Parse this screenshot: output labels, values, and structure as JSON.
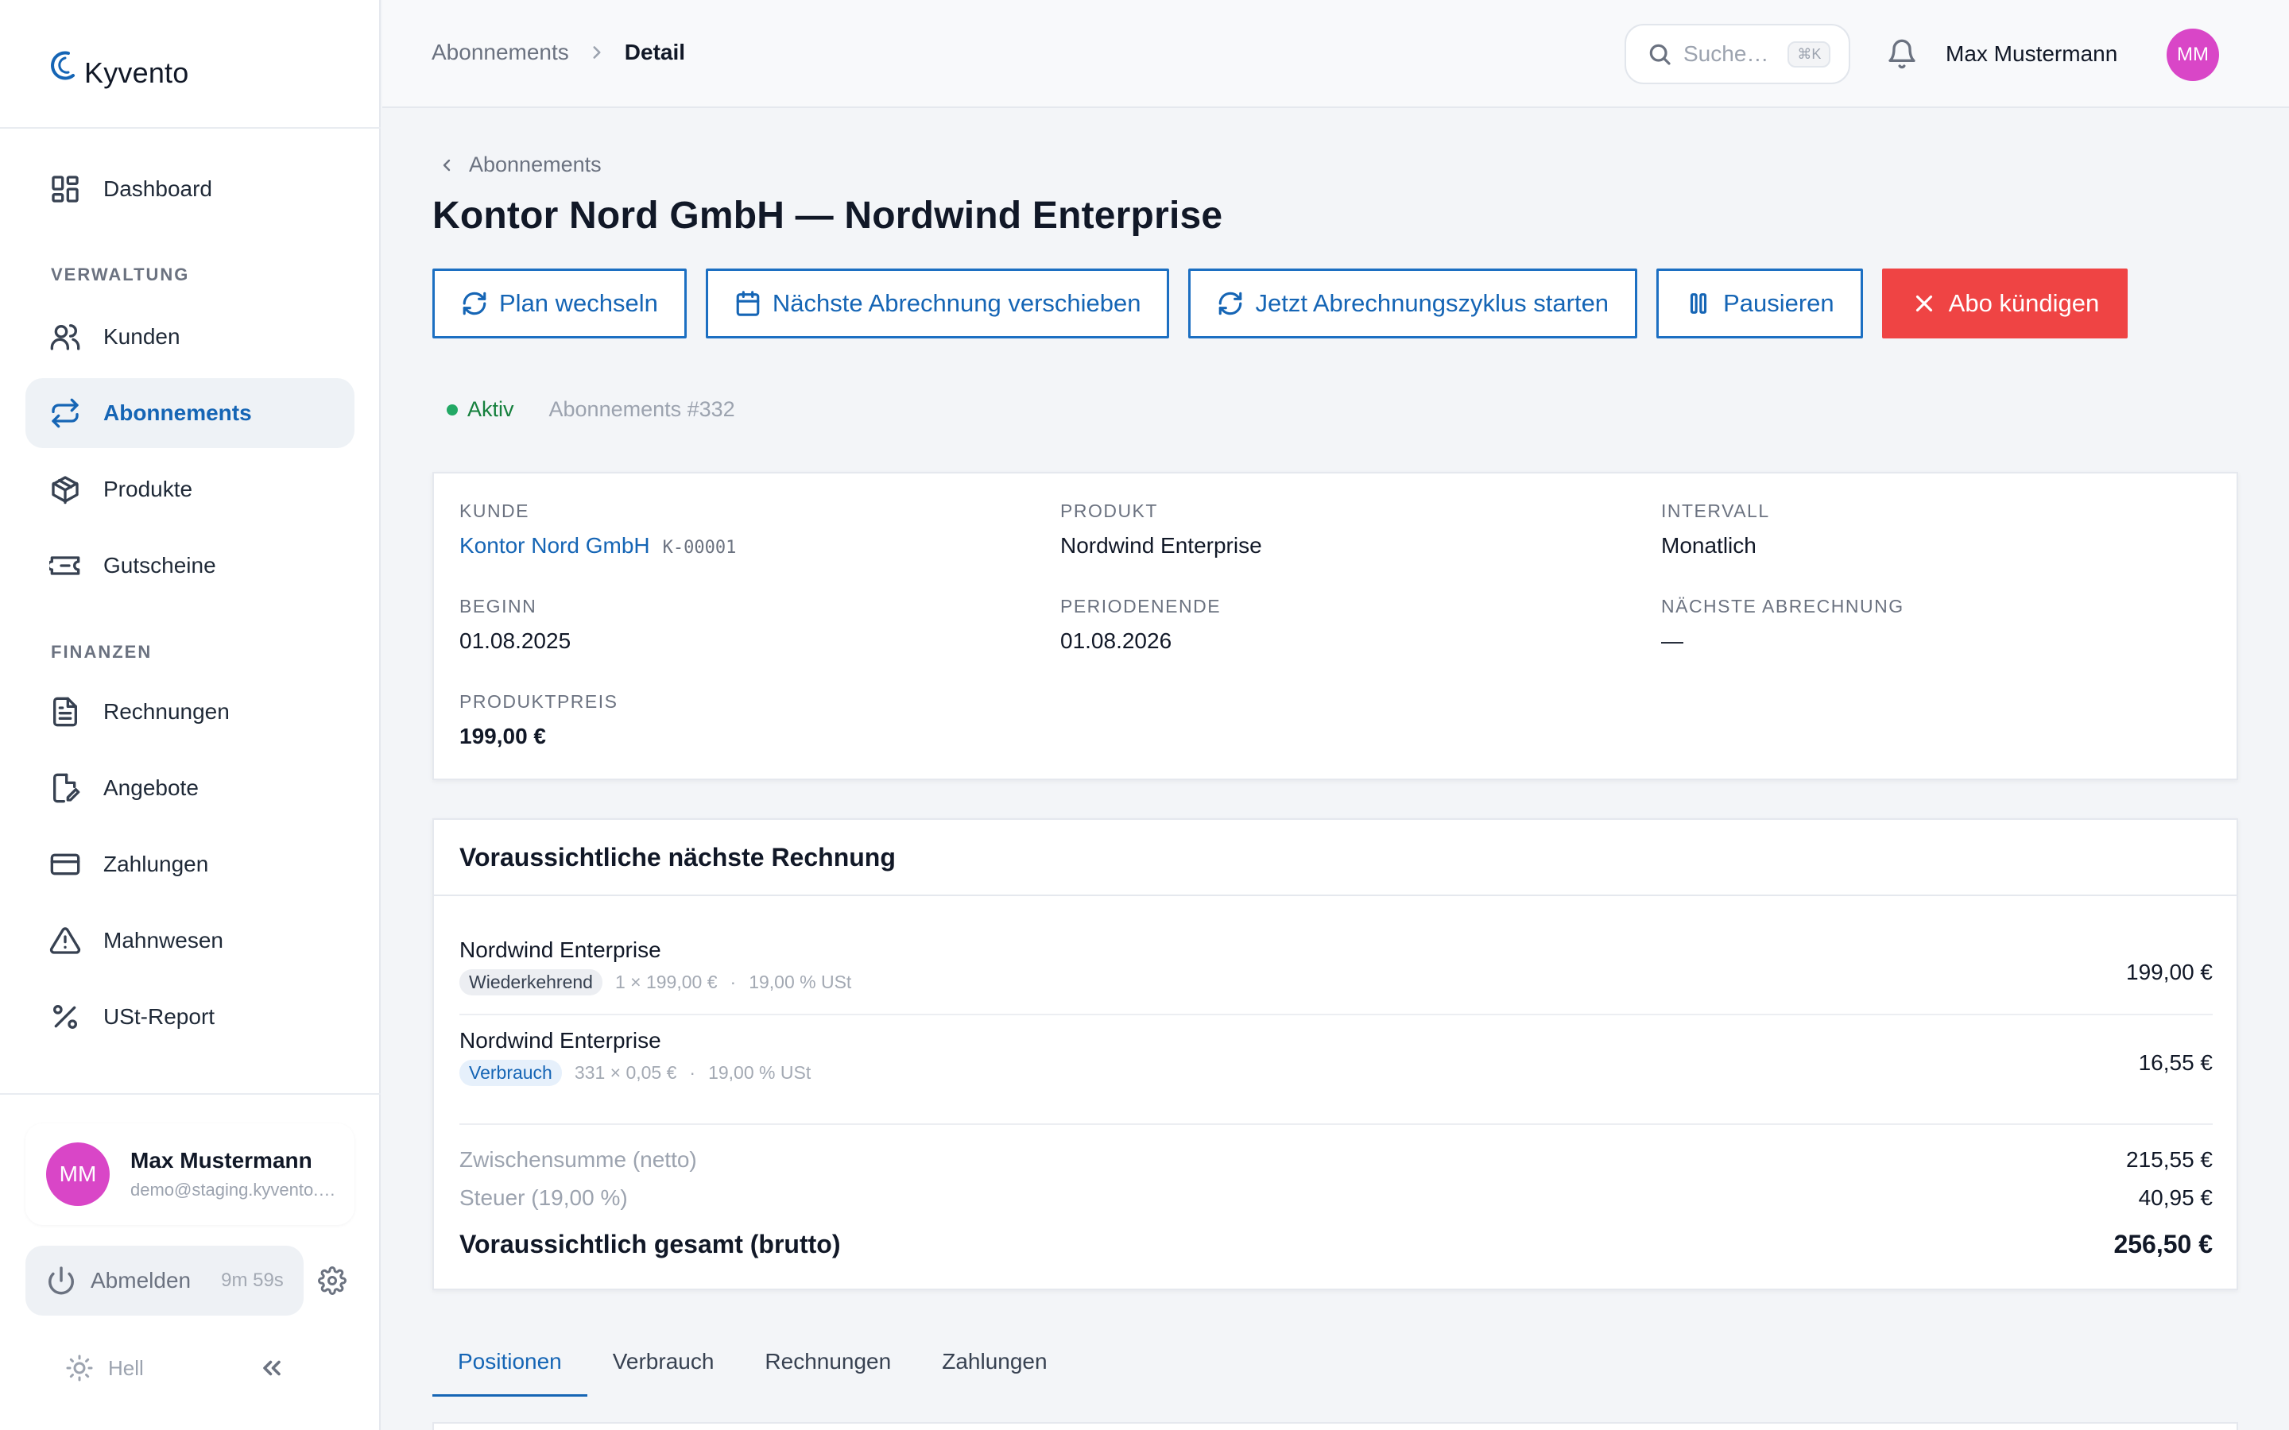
{
  "app": {
    "name": "Kyvento",
    "brand_color": "#1565b5",
    "danger_color": "#ef4444",
    "avatar_color": "#d946c7"
  },
  "sidebar": {
    "dashboard": {
      "label": "Dashboard",
      "icon": "dashboard-icon"
    },
    "sections": [
      {
        "title": "VERWALTUNG",
        "items": [
          {
            "label": "Kunden",
            "icon": "users-icon"
          },
          {
            "label": "Abonnements",
            "icon": "repeat-icon",
            "active": true
          },
          {
            "label": "Produkte",
            "icon": "box-icon"
          },
          {
            "label": "Gutscheine",
            "icon": "ticket-icon"
          }
        ]
      },
      {
        "title": "FINANZEN",
        "items": [
          {
            "label": "Rechnungen",
            "icon": "file-text-icon"
          },
          {
            "label": "Angebote",
            "icon": "file-edit-icon"
          },
          {
            "label": "Zahlungen",
            "icon": "credit-card-icon"
          },
          {
            "label": "Mahnwesen",
            "icon": "alert-triangle-icon"
          },
          {
            "label": "USt-Report",
            "icon": "percent-icon"
          }
        ]
      }
    ],
    "user": {
      "initials": "MM",
      "name": "Max Mustermann",
      "email": "demo@staging.kyvento.de"
    },
    "logout": {
      "label": "Abmelden",
      "timer": "9m 59s"
    },
    "theme": {
      "label": "Hell"
    }
  },
  "topbar": {
    "breadcrumb": {
      "parent": "Abonnements",
      "current": "Detail"
    },
    "search": {
      "placeholder": "Suche…",
      "shortcut": "⌘K"
    },
    "user": {
      "name": "Max Mustermann",
      "initials": "MM"
    }
  },
  "page": {
    "back_label": "Abonnements",
    "title": "Kontor Nord GmbH — Nordwind Enterprise",
    "actions": {
      "change_plan": "Plan wechseln",
      "postpone": "Nächste Abrechnung verschieben",
      "run_cycle": "Jetzt Abrechnungszyklus starten",
      "pause": "Pausieren",
      "cancel": "Abo kündigen"
    },
    "status": {
      "label": "Aktiv",
      "color": "#22a865"
    },
    "subscription_id": "Abonnements #332"
  },
  "details": {
    "customer": {
      "label": "KUNDE",
      "value": "Kontor Nord GmbH",
      "code": "K-00001"
    },
    "product": {
      "label": "PRODUKT",
      "value": "Nordwind Enterprise"
    },
    "interval": {
      "label": "INTERVALL",
      "value": "Monatlich"
    },
    "start": {
      "label": "BEGINN",
      "value": "01.08.2025"
    },
    "period_end": {
      "label": "PERIODENENDE",
      "value": "01.08.2026"
    },
    "next_billing": {
      "label": "NÄCHSTE ABRECHNUNG",
      "value": "—"
    },
    "price": {
      "label": "PRODUKTPREIS",
      "value": "199,00 €"
    }
  },
  "invoice": {
    "title": "Voraussichtliche nächste Rechnung",
    "lines": [
      {
        "name": "Nordwind Enterprise",
        "badge": "Wiederkehrend",
        "qty": "1 × 199,00 €",
        "tax": "19,00 % USt",
        "amount": "199,00 €"
      },
      {
        "name": "Nordwind Enterprise",
        "badge": "Verbrauch",
        "qty": "331 × 0,05 €",
        "tax": "19,00 % USt",
        "amount": "16,55 €"
      }
    ],
    "subtotal": {
      "label": "Zwischensumme (netto)",
      "value": "215,55 €"
    },
    "tax": {
      "label": "Steuer (19,00 %)",
      "value": "40,95 €"
    },
    "total": {
      "label": "Voraussichtlich gesamt (brutto)",
      "value": "256,50 €"
    }
  },
  "tabs": [
    "Positionen",
    "Verbrauch",
    "Rechnungen",
    "Zahlungen"
  ]
}
